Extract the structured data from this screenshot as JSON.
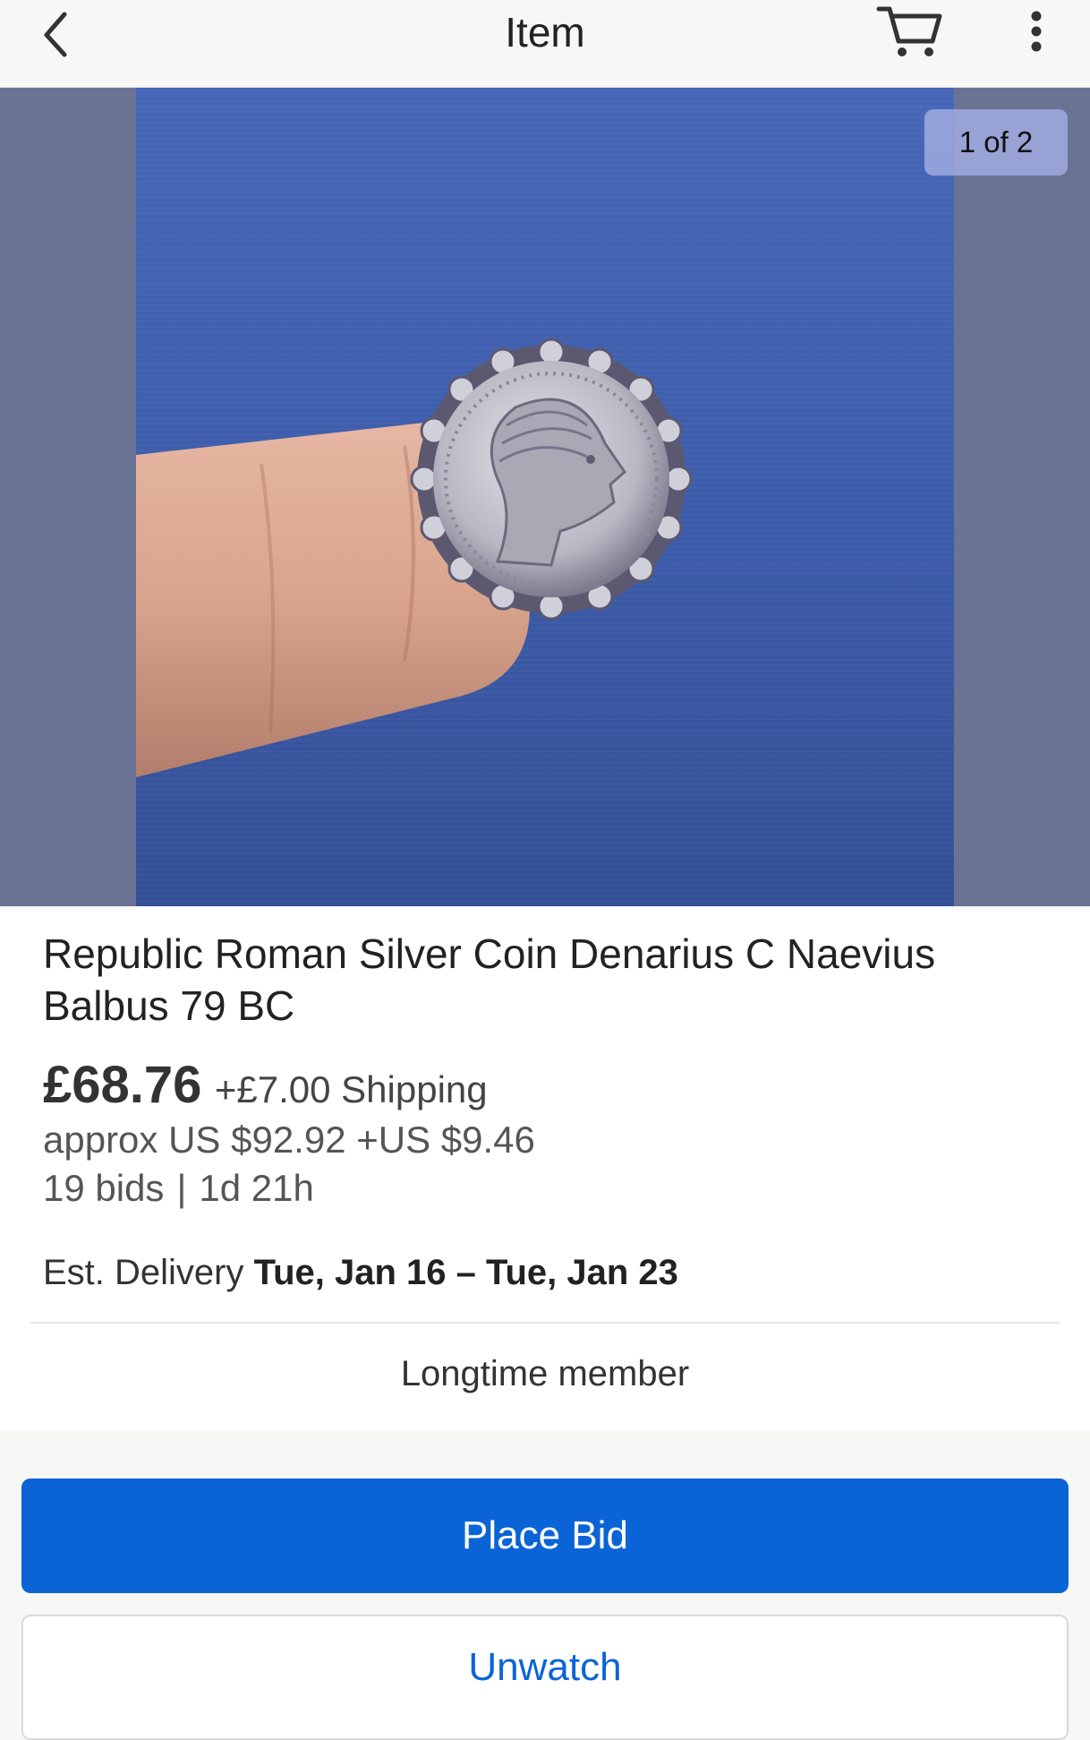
{
  "header": {
    "title": "Item",
    "back_icon": "chevron-left-icon",
    "cart_icon": "cart-icon",
    "more_icon": "more-vertical-icon"
  },
  "gallery": {
    "counter": "1 of 2",
    "image_description_icon": "product-photo"
  },
  "item": {
    "title": "Republic Roman Silver Coin Denarius C Naevius Balbus 79 BC",
    "price": "£68.76",
    "shipping": "+£7.00 Shipping",
    "approx": "approx US $92.92 +US $9.46",
    "bids": "19 bids",
    "bids_separator": "|",
    "time_left": "1d 21h",
    "delivery_label": "Est. Delivery",
    "delivery_dates": "Tue, Jan 16 – Tue, Jan 23",
    "seller_badge": "Longtime member"
  },
  "actions": {
    "place_bid": "Place Bid",
    "unwatch": "Unwatch"
  },
  "colors": {
    "accent": "#0a64d6",
    "gallery_bg": "#6b7394",
    "photo_bg": "#3f5fae"
  }
}
